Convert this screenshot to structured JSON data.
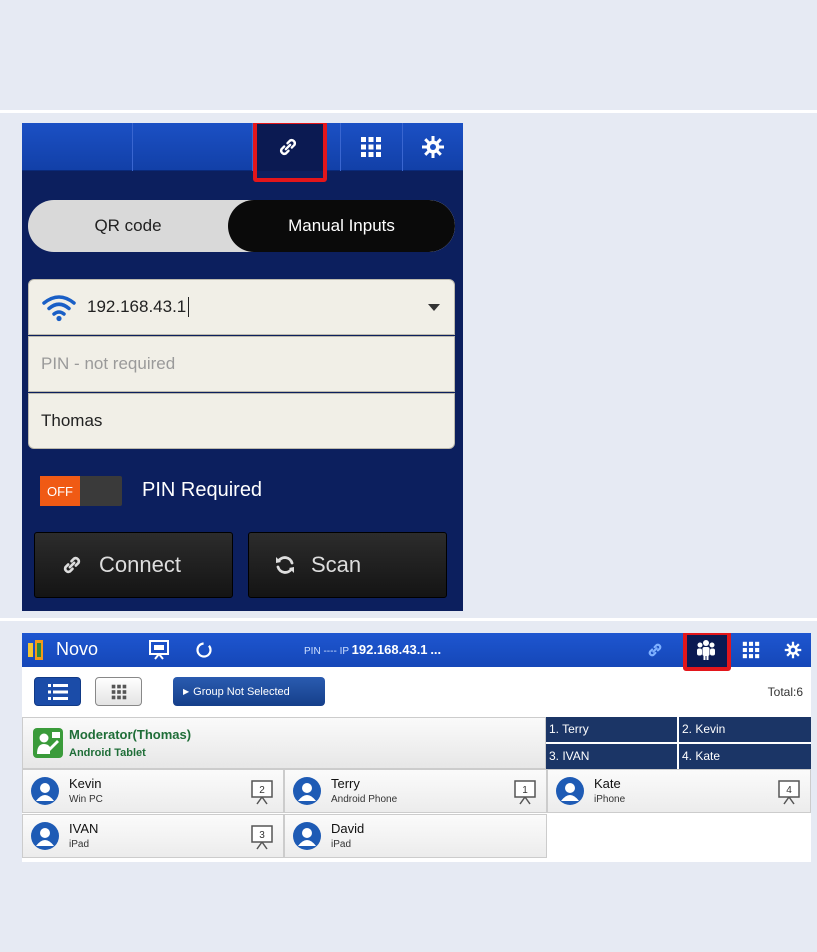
{
  "phone": {
    "segments": {
      "qr": "QR code",
      "manual": "Manual Inputs"
    },
    "ip_value": "192.168.43.1",
    "pin_placeholder": "PIN - not required",
    "name_value": "Thomas",
    "toggle_state": "OFF",
    "pin_required_label": "PIN Required",
    "connect_label": "Connect",
    "scan_label": "Scan",
    "toolbar_icons": [
      "link-icon",
      "grid-icon",
      "gear-icon"
    ]
  },
  "tablet": {
    "app_name": "Novo",
    "pin_label": "PIN",
    "pin_value": "----",
    "ip_label": "IP",
    "ip_value": "192.168.43.1",
    "more": "...",
    "group_button": "Group Not Selected",
    "total": "Total:6",
    "moderator": {
      "name": "Moderator(Thomas)",
      "device": "Android Tablet"
    },
    "slots": [
      "1. Terry",
      "2. Kevin",
      "3. IVAN",
      "4. Kate"
    ],
    "participants": [
      {
        "name": "Kevin",
        "device": "Win PC",
        "slot": "2"
      },
      {
        "name": "Terry",
        "device": "Android Phone",
        "slot": "1"
      },
      {
        "name": "Kate",
        "device": "iPhone",
        "slot": "4"
      },
      {
        "name": "IVAN",
        "device": "iPad",
        "slot": "3"
      },
      {
        "name": "David",
        "device": "iPad",
        "slot": ""
      }
    ]
  },
  "colors": {
    "highlight": "#e3161b",
    "toolbar_blue": "#1b50c4",
    "phone_bg": "#0c1f5e",
    "toggle_off": "#f05a14"
  }
}
